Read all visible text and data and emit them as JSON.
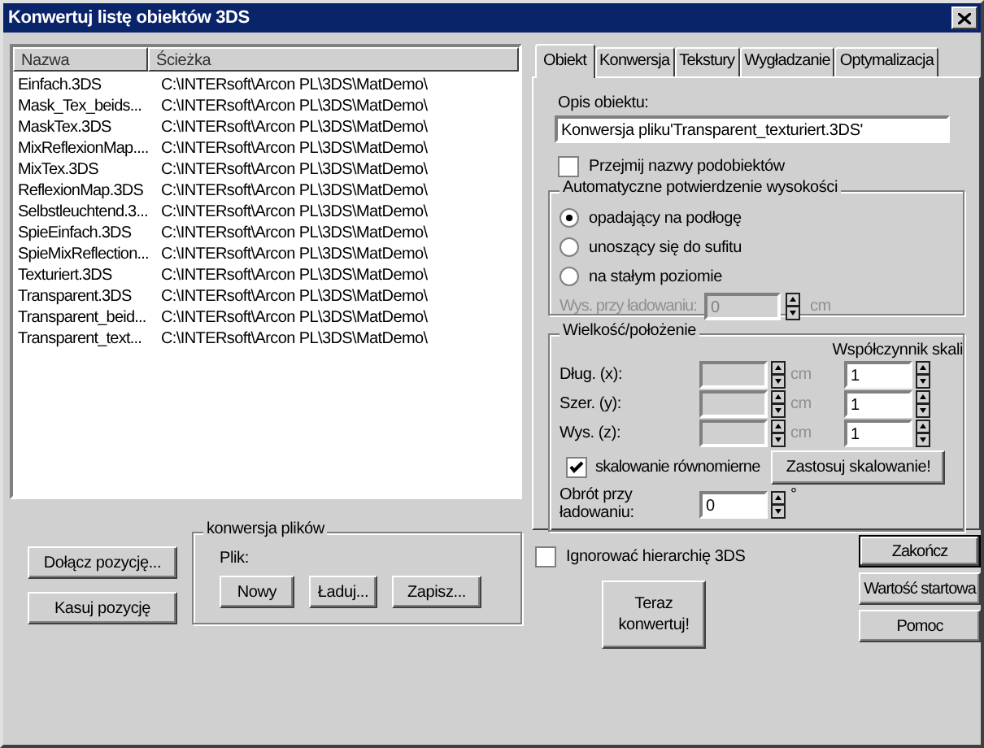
{
  "window": {
    "title": "Konwertuj listę obiektów 3DS"
  },
  "file_list": {
    "columns": [
      "Nazwa",
      "Ścieżka"
    ],
    "rows": [
      {
        "name": "Einfach.3DS",
        "path": "C:\\INTERsoft\\Arcon PL\\3DS\\MatDemo\\"
      },
      {
        "name": "Mask_Tex_beids...",
        "path": "C:\\INTERsoft\\Arcon PL\\3DS\\MatDemo\\"
      },
      {
        "name": "MaskTex.3DS",
        "path": "C:\\INTERsoft\\Arcon PL\\3DS\\MatDemo\\"
      },
      {
        "name": "MixReflexionMap....",
        "path": "C:\\INTERsoft\\Arcon PL\\3DS\\MatDemo\\"
      },
      {
        "name": "MixTex.3DS",
        "path": "C:\\INTERsoft\\Arcon PL\\3DS\\MatDemo\\"
      },
      {
        "name": "ReflexionMap.3DS",
        "path": "C:\\INTERsoft\\Arcon PL\\3DS\\MatDemo\\"
      },
      {
        "name": "Selbstleuchtend.3...",
        "path": "C:\\INTERsoft\\Arcon PL\\3DS\\MatDemo\\"
      },
      {
        "name": "SpieEinfach.3DS",
        "path": "C:\\INTERsoft\\Arcon PL\\3DS\\MatDemo\\"
      },
      {
        "name": "SpieMixReflection...",
        "path": "C:\\INTERsoft\\Arcon PL\\3DS\\MatDemo\\"
      },
      {
        "name": "Texturiert.3DS",
        "path": "C:\\INTERsoft\\Arcon PL\\3DS\\MatDemo\\"
      },
      {
        "name": "Transparent.3DS",
        "path": "C:\\INTERsoft\\Arcon PL\\3DS\\MatDemo\\"
      },
      {
        "name": "Transparent_beid...",
        "path": "C:\\INTERsoft\\Arcon PL\\3DS\\MatDemo\\"
      },
      {
        "name": "Transparent_text...",
        "path": "C:\\INTERsoft\\Arcon PL\\3DS\\MatDemo\\"
      }
    ]
  },
  "list_buttons": [
    "Dołącz pozycję...",
    "Kasuj pozycję"
  ],
  "file_conversion": {
    "title": "konwersja plików",
    "file_label": "Plik:",
    "buttons": [
      "Nowy",
      "Ładuj...",
      "Zapisz..."
    ]
  },
  "tabs": [
    {
      "label": "Obiekt",
      "selected": true
    },
    {
      "label": "Konwersja",
      "selected": false
    },
    {
      "label": "Tekstury",
      "selected": false
    },
    {
      "label": "Wygładzanie",
      "selected": false
    },
    {
      "label": "Optymalizacja",
      "selected": false
    }
  ],
  "object_tab": {
    "description_label": "Opis obiektu:",
    "description_value": "Konwersja pliku'Transparent_texturiert.3DS'",
    "take_subobject_names": {
      "label": "Przejmij nazwy podobiektów",
      "checked": false
    },
    "height_group": {
      "title": "Automatyczne potwierdzenie wysokości",
      "options": [
        {
          "label": "opadający na podłogę",
          "selected": true
        },
        {
          "label": "unoszący się do sufitu",
          "selected": false
        },
        {
          "label": "na stałym poziomie",
          "selected": false
        }
      ],
      "load_height": {
        "label": "Wys. przy ładowaniu:",
        "value": "0",
        "unit": "cm",
        "disabled": true
      }
    },
    "size_group": {
      "title": "Wielkość/położenie",
      "scale_header": "Współczynnik skali",
      "rows": [
        {
          "label": "Dług. (x):",
          "unit": "cm",
          "disabled": true,
          "scale": "1"
        },
        {
          "label": "Szer. (y):",
          "unit": "cm",
          "disabled": true,
          "scale": "1"
        },
        {
          "label": "Wys. (z):",
          "unit": "cm",
          "disabled": true,
          "scale": "1"
        }
      ],
      "uniform_scaling": {
        "label": "skalowanie równomierne",
        "checked": true
      },
      "apply_button": "Zastosuj skalowanie!",
      "rotation": {
        "label": "Obrót przy ładowaniu:",
        "value": "0",
        "unit": "°"
      }
    }
  },
  "ignore_hierarchy": {
    "label": "Ignorować hierarchię 3DS",
    "checked": false
  },
  "convert_button": "Teraz konwertuj!",
  "side_buttons": [
    {
      "label": "Zakończ",
      "default": true
    },
    {
      "label": "Wartość startowa",
      "default": false
    },
    {
      "label": "Pomoc",
      "default": false
    }
  ]
}
